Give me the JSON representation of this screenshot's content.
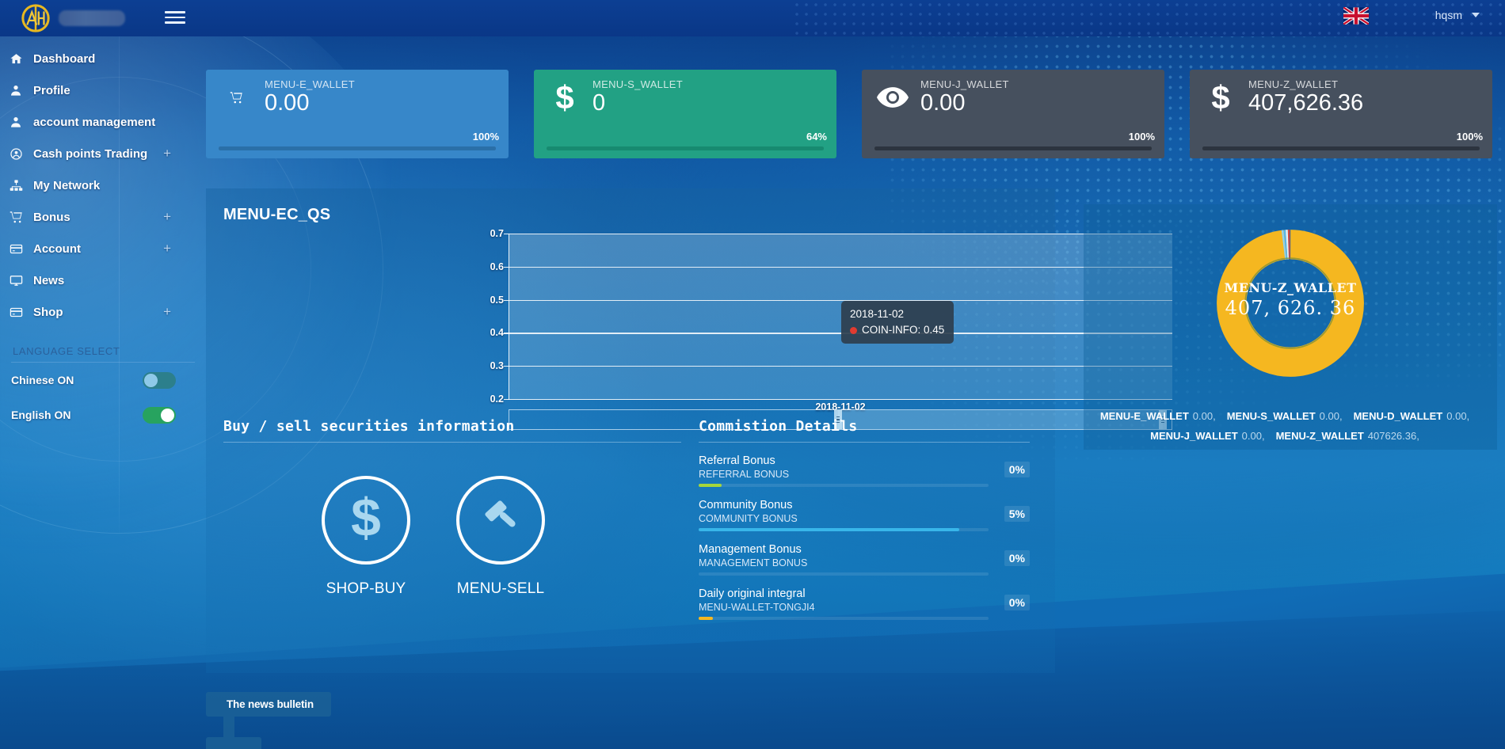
{
  "topbar": {
    "logo_icon": "ah-monogram-logo",
    "brand_redacted": "",
    "menu_icon": "hamburger-menu-icon",
    "flag_icon": "uk-flag-icon",
    "username": "hqsm",
    "caret_icon": "chevron-down-icon"
  },
  "sidebar": {
    "items": [
      {
        "label": "Dashboard",
        "icon": "home-icon",
        "expandable": ""
      },
      {
        "label": "Profile",
        "icon": "user-icon",
        "expandable": ""
      },
      {
        "label": "account management",
        "icon": "user-gear-icon",
        "expandable": ""
      },
      {
        "label": "Cash points Trading",
        "icon": "user-circle-icon",
        "expandable": "+"
      },
      {
        "label": "My Network",
        "icon": "sitemap-icon",
        "expandable": ""
      },
      {
        "label": "Bonus",
        "icon": "cart-icon",
        "expandable": "+"
      },
      {
        "label": "Account",
        "icon": "credit-card-icon",
        "expandable": "+"
      },
      {
        "label": "News",
        "icon": "monitor-icon",
        "expandable": ""
      },
      {
        "label": "Shop",
        "icon": "credit-card-icon",
        "expandable": "+"
      }
    ],
    "language_section_title": "LANGUAGE SELECT",
    "languages": [
      {
        "label": "Chinese ON",
        "state": "on",
        "color": "#2c7f8c"
      },
      {
        "label": "English ON",
        "state": "on",
        "color": "#27a35f"
      }
    ]
  },
  "cards": [
    {
      "label": "MENU-E_WALLET",
      "value": "0.00",
      "percent": "100%",
      "fill": 100,
      "icon": "cart-icon",
      "theme": "blue"
    },
    {
      "label": "MENU-S_WALLET",
      "value": "0",
      "percent": "64%",
      "fill": 100,
      "icon": "dollar-icon",
      "theme": "green"
    },
    {
      "label": "MENU-J_WALLET",
      "value": "0.00",
      "percent": "100%",
      "fill": 100,
      "icon": "eye-icon",
      "theme": "dark"
    },
    {
      "label": "MENU-Z_WALLET",
      "value": "407,626.36",
      "percent": "100%",
      "fill": 100,
      "icon": "dollar-icon",
      "theme": "dark"
    }
  ],
  "main_panel": {
    "title": "MENU-EC_QS"
  },
  "chart_data": {
    "type": "line",
    "title": "MENU-EC_QS",
    "series": [
      {
        "name": "COIN-INFO",
        "color": "#e23b30",
        "values": [
          0.45
        ]
      }
    ],
    "x": [
      "2018-11-02"
    ],
    "categories": [
      "2018-11-02"
    ],
    "xlabel": "",
    "ylabel": "",
    "ylim": [
      0.2,
      0.7
    ],
    "yticks": [
      "0.7",
      "0.6",
      "0.5",
      "0.4",
      "0.3",
      "0.2"
    ],
    "xticks": [
      "2018-11-02"
    ],
    "grid": true,
    "legend": "none",
    "tooltip": {
      "title": "2018-11-02",
      "series_label": "COIN-INFO",
      "series_value": "0.45",
      "marker_color": "#e23b30"
    },
    "datazoom": {
      "start_pct": 50,
      "end_pct": 99
    }
  },
  "buy_sell": {
    "title": "Buy / sell securities information",
    "actions": [
      {
        "label": "SHOP-BUY",
        "icon": "dollar-sign-icon"
      },
      {
        "label": "MENU-SELL",
        "icon": "gavel-icon"
      }
    ]
  },
  "commission": {
    "title": "Commistion Details",
    "rows": [
      {
        "name": "Referral Bonus",
        "sub": "REFERRAL BONUS",
        "percent": "0%",
        "fill": 8,
        "color": "#a6d63b"
      },
      {
        "name": "Community Bonus",
        "sub": "COMMUNITY BONUS",
        "percent": "5%",
        "fill": 90,
        "color": "#38b6ea"
      },
      {
        "name": "Management Bonus",
        "sub": "MANAGEMENT BONUS",
        "percent": "0%",
        "fill": 0,
        "color": "#f0a32a"
      },
      {
        "name": "Daily original integral",
        "sub": "MENU-WALLET-TONGJI4",
        "percent": "0%",
        "fill": 5,
        "color": "#f5b720"
      }
    ]
  },
  "donut": {
    "center_title": "MENU-Z_WALLET",
    "center_value": "407, 626. 36",
    "chart_data": {
      "type": "pie",
      "title": "MENU-Z_WALLET",
      "labels": [
        "MENU-E_WALLET",
        "MENU-S_WALLET",
        "MENU-D_WALLET",
        "MENU-J_WALLET",
        "MENU-Z_WALLET"
      ],
      "values": [
        0.0,
        0.0,
        0.0,
        0.0,
        407626.36
      ],
      "colors": [
        "#8fd3f4",
        "#e6f2f8",
        "#d94a3d",
        "#5ab7e8",
        "#f5b720"
      ]
    },
    "legend": [
      {
        "name": "MENU-E_WALLET",
        "value": "0.00,"
      },
      {
        "name": "MENU-S_WALLET",
        "value": "0.00,"
      },
      {
        "name": "MENU-D_WALLET",
        "value": "0.00,"
      },
      {
        "name": "MENU-J_WALLET",
        "value": "0.00,"
      },
      {
        "name": "MENU-Z_WALLET",
        "value": "407626.36,"
      }
    ]
  },
  "news_bulletin": {
    "label": "The news bulletin"
  }
}
